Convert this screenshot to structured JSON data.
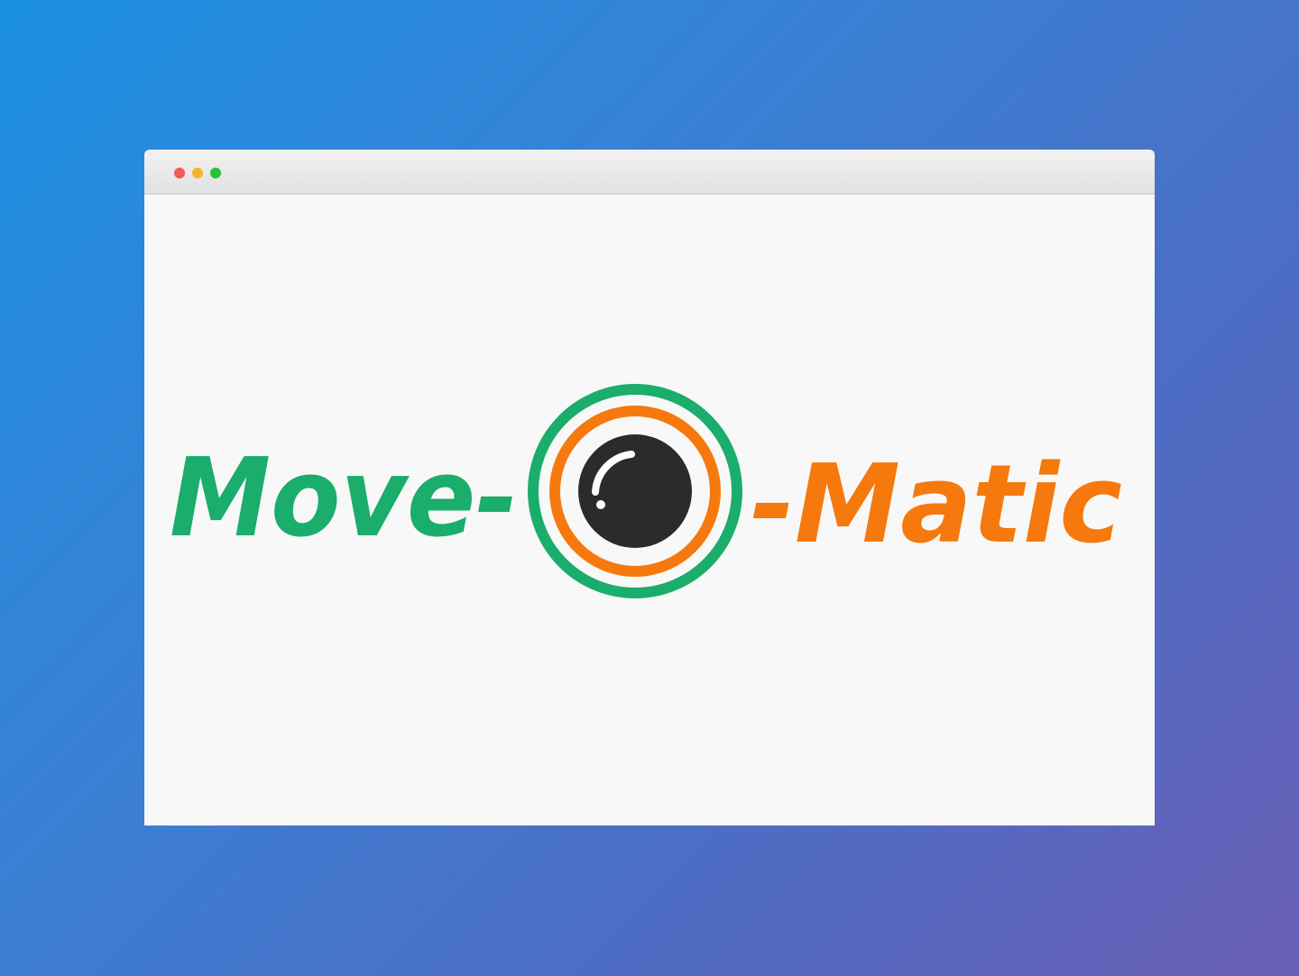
{
  "window": {
    "controls": [
      {
        "name": "close-button",
        "color": "#f25a57"
      },
      {
        "name": "minimize-button",
        "color": "#f4b526"
      },
      {
        "name": "maximize-button",
        "color": "#25c23a"
      }
    ]
  },
  "logo": {
    "left_text": "Move-",
    "right_text": "-Matic",
    "colors": {
      "green": "#1aad6b",
      "orange": "#f6790e",
      "lens": "#2b2b2b",
      "highlight": "#ffffff"
    },
    "icon": "camera-lens-icon"
  }
}
